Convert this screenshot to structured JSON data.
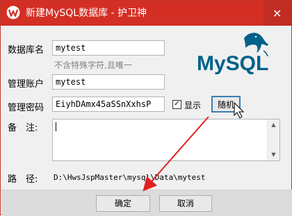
{
  "window": {
    "title": "新建MySQL数据库 - 护卫神",
    "close_label": "✕"
  },
  "logo": {
    "text": "MySQL",
    "text_color": "#00618a",
    "accent": "#e48e00"
  },
  "form": {
    "dbname": {
      "label": "数据库名",
      "value": "mytest",
      "hint": "不含特殊字符,且唯一"
    },
    "account": {
      "label": "管理账户",
      "value": "mytest"
    },
    "password": {
      "label": "管理密码",
      "value": "EiyhDAmx45aSSnXxhsP",
      "show_label": "显示",
      "show_checked": true,
      "random_label": "随机"
    },
    "remark": {
      "label": "备　注:",
      "value": ""
    },
    "path": {
      "label": "路　径:",
      "value": "D:\\HwsJspMaster\\mysql\\Data\\mytest"
    }
  },
  "buttons": {
    "ok": "确定",
    "cancel": "取消"
  },
  "colors": {
    "titlebar": "#d42f25",
    "annotation_arrow": "#e02020"
  }
}
